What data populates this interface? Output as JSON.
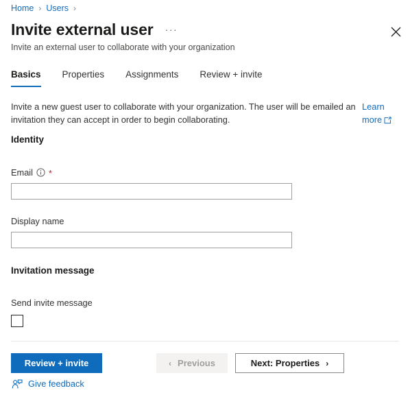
{
  "breadcrumb": {
    "items": [
      {
        "label": "Home"
      },
      {
        "label": "Users"
      }
    ],
    "separator": "›"
  },
  "header": {
    "title": "Invite external user",
    "ellipsis_label": "···",
    "subtitle": "Invite an external user to collaborate with your organization",
    "close_icon": "close-icon"
  },
  "tabs": [
    {
      "label": "Basics",
      "active": true
    },
    {
      "label": "Properties",
      "active": false
    },
    {
      "label": "Assignments",
      "active": false
    },
    {
      "label": "Review + invite",
      "active": false
    }
  ],
  "intro": {
    "text": "Invite a new guest user to collaborate with your organization. The user will be emailed an invitation they can accept in order to begin collaborating.",
    "learn_more_label": "Learn more",
    "learn_more_icon": "external-link-icon"
  },
  "sections": {
    "identity": {
      "heading": "Identity",
      "email": {
        "label": "Email",
        "info_icon": "info-icon",
        "required_marker": "*",
        "value": "",
        "placeholder": ""
      },
      "display_name": {
        "label": "Display name",
        "value": "",
        "placeholder": ""
      }
    },
    "invitation": {
      "heading": "Invitation message",
      "send_invite": {
        "label": "Send invite message",
        "checked": false
      }
    }
  },
  "footer": {
    "review_invite_label": "Review + invite",
    "previous_label": "Previous",
    "previous_chevron": "‹",
    "next_label": "Next: Properties",
    "next_chevron": "›",
    "feedback_label": "Give feedback",
    "feedback_icon": "person-feedback-icon"
  },
  "colors": {
    "accent_blue": "#0f6cbd",
    "required_red": "#a4262c",
    "disabled_bg": "#f3f2f1",
    "border_gray": "#a19f9d"
  }
}
